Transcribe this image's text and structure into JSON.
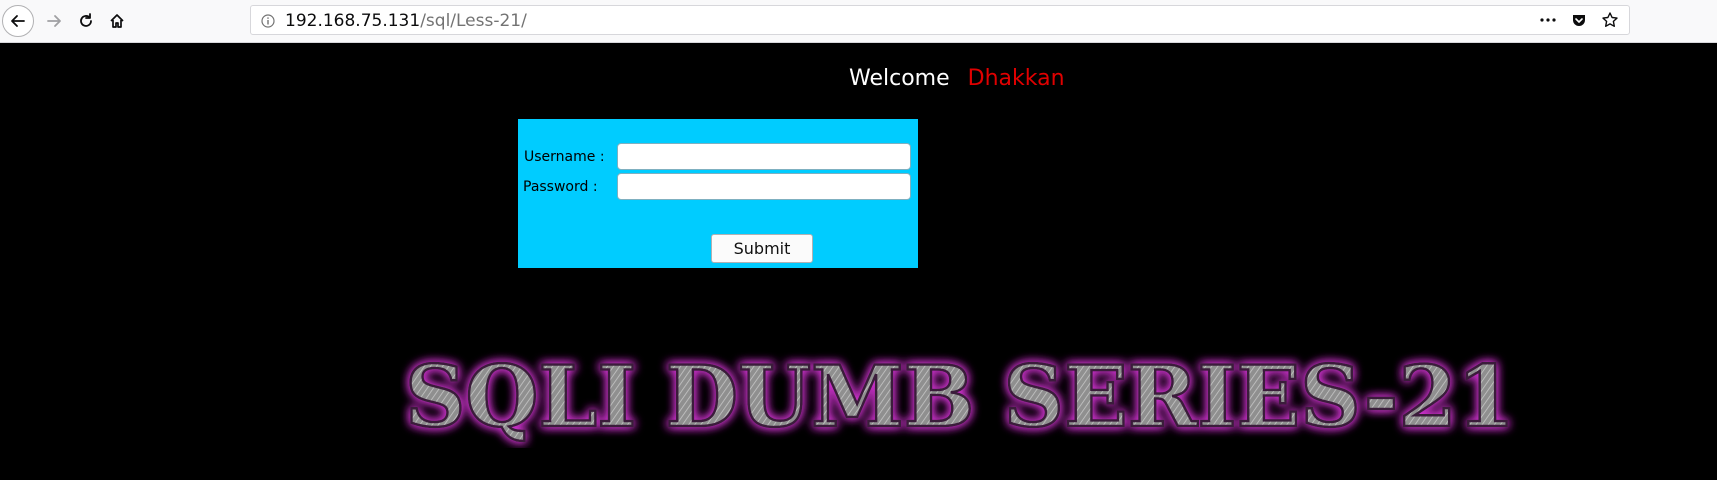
{
  "browser": {
    "url_host": "192.168.75.131",
    "url_path": "/sql/Less-21/",
    "icons": {
      "back": "arrow-left-icon",
      "forward": "arrow-right-icon",
      "reload": "reload-icon",
      "home": "home-icon",
      "info": "info-icon",
      "more": "ellipsis-icon",
      "pocket": "pocket-icon",
      "bookmark": "star-icon"
    }
  },
  "page": {
    "welcome_label": "Welcome",
    "welcome_name": "Dhakkan",
    "form": {
      "username_label": "Username :",
      "password_label": "Password :",
      "username_value": "",
      "password_value": "",
      "submit_label": "Submit"
    },
    "banner": "SQLI DUMB SERIES-21"
  },
  "colors": {
    "background": "#000000",
    "form_bg": "#00ccff",
    "name_color": "#e00000",
    "banner_glow": "#cc33cc"
  }
}
